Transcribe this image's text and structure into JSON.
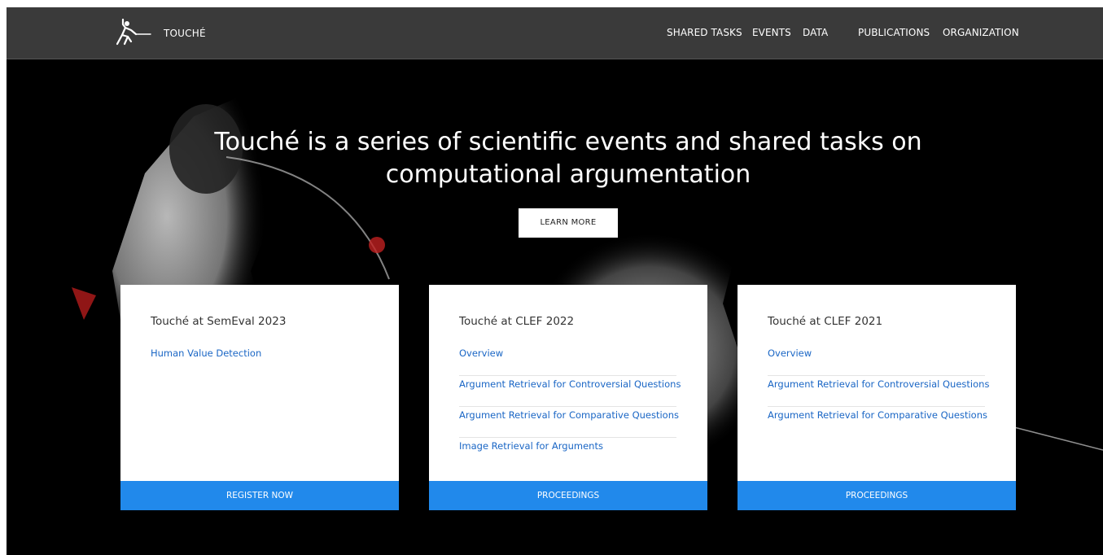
{
  "brand": {
    "name": "TOUCHÉ",
    "logo_icon": "fencer-logo-icon"
  },
  "nav": {
    "items": [
      "SHARED TASKS",
      "EVENTS",
      "DATA",
      "PUBLICATIONS",
      "ORGANIZATION"
    ]
  },
  "hero": {
    "title": "Touché is a series of scientific events and shared tasks on computational argumentation",
    "button": "LEARN MORE"
  },
  "cards": [
    {
      "title": "Touché at SemEval 2023",
      "links": [
        "Human Value Detection"
      ],
      "button": "REGISTER NOW"
    },
    {
      "title": "Touché at CLEF 2022",
      "links": [
        "Overview",
        "Argument Retrieval for Controversial Questions",
        "Argument Retrieval for Comparative Questions",
        "Image Retrieval for Arguments"
      ],
      "button": "PROCEEDINGS"
    },
    {
      "title": "Touché at CLEF 2021",
      "links": [
        "Overview",
        "Argument Retrieval for Controversial Questions",
        "Argument Retrieval for Comparative Questions"
      ],
      "button": "PROCEEDINGS"
    }
  ],
  "colors": {
    "navbar": "#3a3a3a",
    "accent": "#2189eb",
    "link": "#1a66c5"
  }
}
